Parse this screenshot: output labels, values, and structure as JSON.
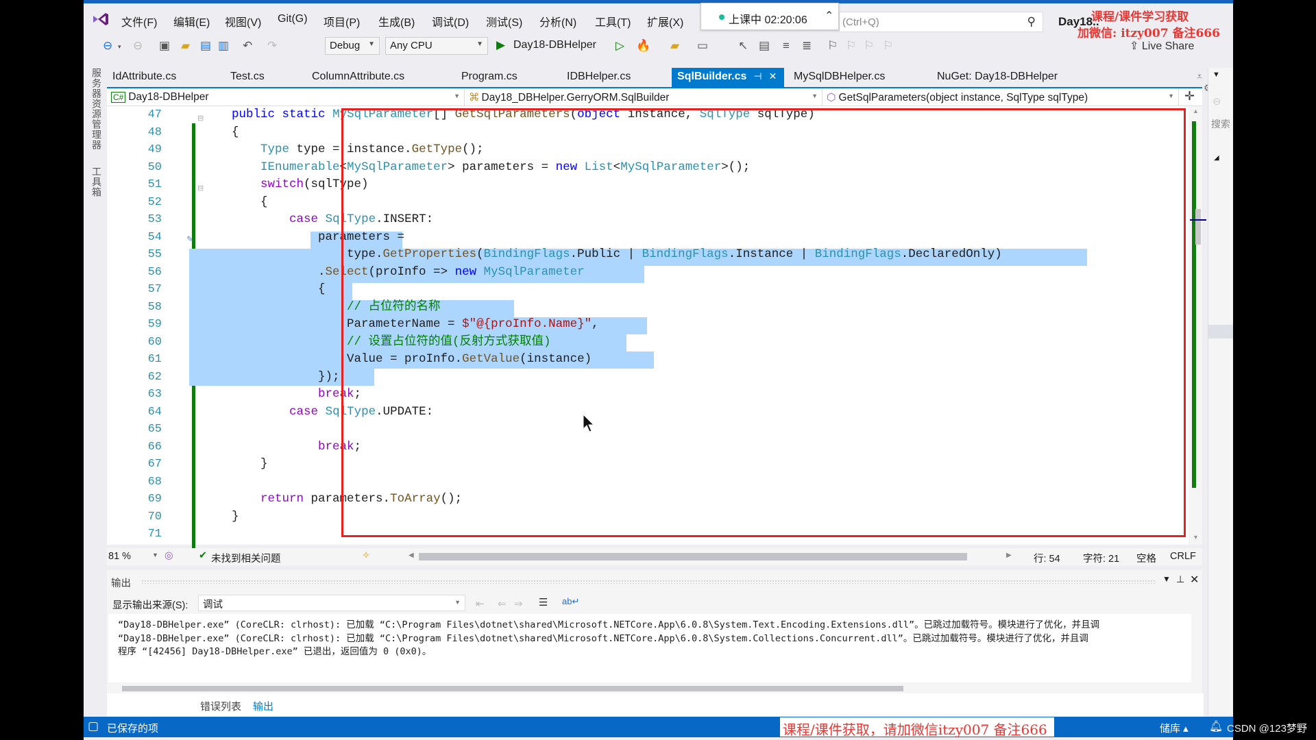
{
  "menu": {
    "items": [
      "文件(F)",
      "编辑(E)",
      "视图(V)",
      "Git(G)",
      "项目(P)",
      "生成(B)",
      "调试(D)",
      "测试(S)",
      "分析(N)",
      "工具(T)",
      "扩展(X)"
    ],
    "timer": "上课中 02:20:06",
    "search_placeholder": "(Ctrl+Q)",
    "solution_name": "Day18.."
  },
  "watermark": {
    "top_line1": "课程/课件学习获取",
    "top_line2": "加微信: itzy007 备注666",
    "bottom": "课程/课件获取，请加微信itzy007 备注666",
    "csdn": "CSDN @123梦野"
  },
  "toolbar": {
    "config": "Debug",
    "platform": "Any CPU",
    "run_target": "Day18-DBHelper",
    "live_share": "Live Share"
  },
  "left_strip": {
    "tabs": [
      "服务器资源管理器",
      "工具箱"
    ]
  },
  "doc_tabs": [
    {
      "label": "IdAttribute.cs",
      "active": false
    },
    {
      "label": "Test.cs",
      "active": false
    },
    {
      "label": "ColumnAttribute.cs",
      "active": false
    },
    {
      "label": "Program.cs",
      "active": false
    },
    {
      "label": "IDBHelper.cs",
      "active": false
    },
    {
      "label": "SqlBuilder.cs",
      "active": true
    },
    {
      "label": "MySqlDBHelper.cs",
      "active": false
    },
    {
      "label": "NuGet: Day18-DBHelper",
      "active": false
    }
  ],
  "navbar": {
    "project": "Day18-DBHelper",
    "class": "Day18_DBHelper.GerryORM.SqlBuilder",
    "member": "GetSqlParameters(object instance, SqlType sqlType)"
  },
  "editor": {
    "line_numbers": [
      "47",
      "48",
      "49",
      "50",
      "51",
      "52",
      "53",
      "54",
      "55",
      "56",
      "57",
      "58",
      "59",
      "60",
      "61",
      "62",
      "63",
      "64",
      "65",
      "66",
      "67",
      "68",
      "69",
      "70",
      "71"
    ],
    "code_lines": [
      "    public static MySqlParameter[] GetSqlParameters(object instance, SqlType sqlType)",
      "    {",
      "        Type type = instance.GetType();",
      "        IEnumerable<MySqlParameter> parameters = new List<MySqlParameter>();",
      "        switch(sqlType)",
      "        {",
      "            case SqlType.INSERT:",
      "                parameters =",
      "                    type.GetProperties(BindingFlags.Public | BindingFlags.Instance | BindingFlags.DeclaredOnly)",
      "                .Select(proInfo => new MySqlParameter",
      "                {",
      "                    // 占位符的名称",
      "                    ParameterName = $\"@{proInfo.Name}\",",
      "                    // 设置占位符的值(反射方式获取值)",
      "                    Value = proInfo.GetValue(instance)",
      "                });",
      "                break;",
      "            case SqlType.UPDATE:",
      "",
      "                break;",
      "        }",
      "",
      "        return parameters.ToArray();",
      "    }",
      ""
    ]
  },
  "editor_status": {
    "zoom": "81 %",
    "issues": "未找到相关问题",
    "line": "行: 54",
    "char": "字符: 21",
    "indent": "空格",
    "eol": "CRLF"
  },
  "output": {
    "title": "输出",
    "source_label": "显示输出来源(S):",
    "source_value": "调试",
    "lines": [
      "“Day18-DBHelper.exe” (CoreCLR: clrhost): 已加载 “C:\\Program Files\\dotnet\\shared\\Microsoft.NETCore.App\\6.0.8\\System.Text.Encoding.Extensions.dll”。已跳过加载符号。模块进行了优化，并且调",
      "“Day18-DBHelper.exe” (CoreCLR: clrhost): 已加载 “C:\\Program Files\\dotnet\\shared\\Microsoft.NETCore.App\\6.0.8\\System.Collections.Concurrent.dll”。已跳过加载符号。模块进行了优化，并且调",
      "程序 “[42456] Day18-DBHelper.exe” 已退出，返回值为 0 (0x0)。"
    ]
  },
  "bottom_tabs": [
    {
      "label": "错误列表",
      "active": false
    },
    {
      "label": "输出",
      "active": true
    }
  ],
  "statusbar": {
    "text": "已保存的项",
    "repo": "储库"
  },
  "colors": {
    "accent": "#007acc",
    "statusbar": "#0868c6",
    "selection": "#add6ff",
    "highlight_box": "#e8201f",
    "change_bar": "#107c10"
  }
}
